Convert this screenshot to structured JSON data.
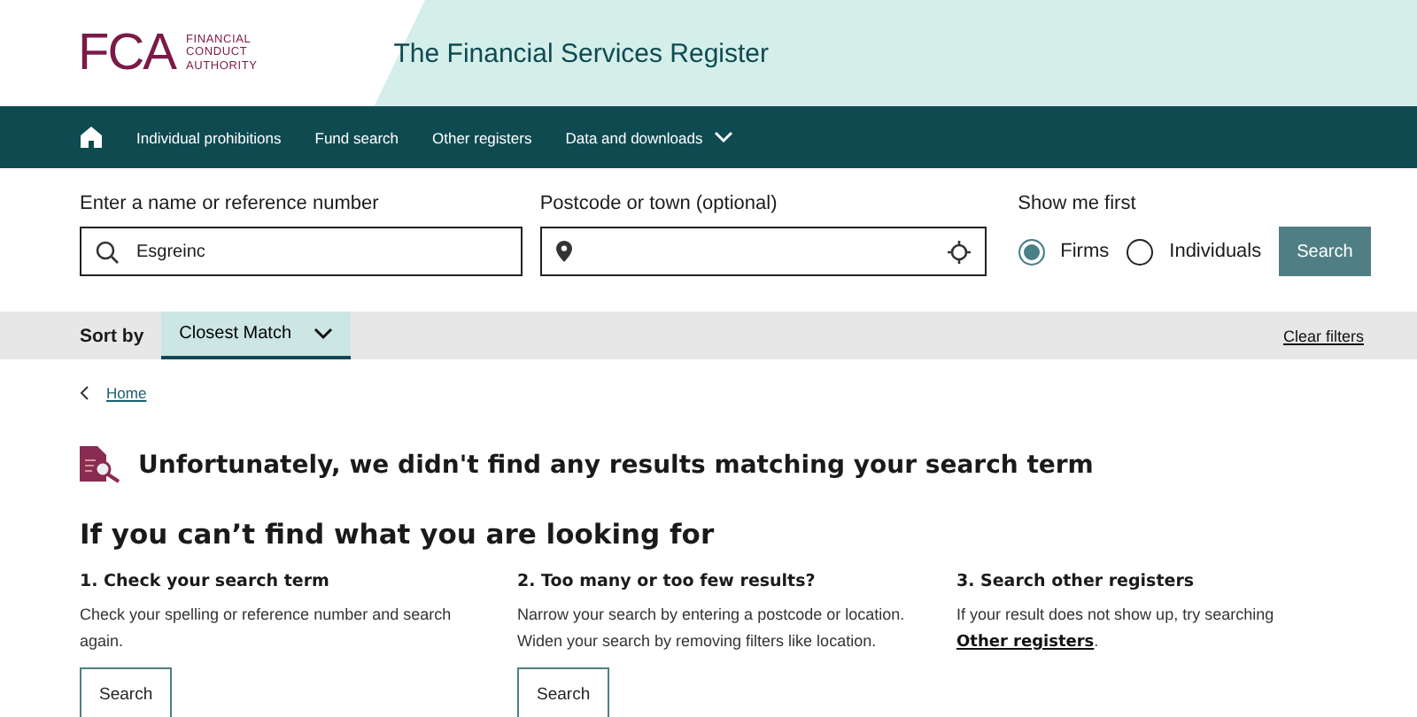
{
  "logo": {
    "letters": "FCA",
    "name_lines": [
      "FINANCIAL",
      "CONDUCT",
      "AUTHORITY"
    ]
  },
  "header": {
    "title": "The Financial Services Register"
  },
  "nav": {
    "items": [
      {
        "label": "Individual prohibitions",
        "kind": "link"
      },
      {
        "label": "Fund search",
        "kind": "link"
      },
      {
        "label": "Other registers",
        "kind": "link"
      },
      {
        "label": "Data and downloads",
        "kind": "dropdown"
      }
    ]
  },
  "search": {
    "name_label": "Enter a name or reference number",
    "name_value": "Esgreinc",
    "place_label": "Postcode or town (optional)",
    "show_label": "Show me first",
    "options": [
      {
        "label": "Firms",
        "selected": true
      },
      {
        "label": "Individuals",
        "selected": false
      }
    ],
    "button": "Search"
  },
  "sort": {
    "label": "Sort by",
    "value": "Closest Match",
    "clear": "Clear filters"
  },
  "breadcrumb": "Home",
  "message": "Unfortunately, we didn't find any results matching your search term",
  "help": {
    "title": "If you can’t find what you are looking for",
    "columns": [
      {
        "title": "1. Check your search term",
        "text": "Check your spelling or reference number and search again.",
        "button": "Search"
      },
      {
        "title": "2. Too many or too few results?",
        "text": "Narrow your search by entering a postcode or location. Widen your search by removing filters like location.",
        "button": "Search"
      },
      {
        "title": "3. Search other registers",
        "text": "If your result does not show up, try searching",
        "link": "Other registers",
        "end": "."
      }
    ]
  }
}
